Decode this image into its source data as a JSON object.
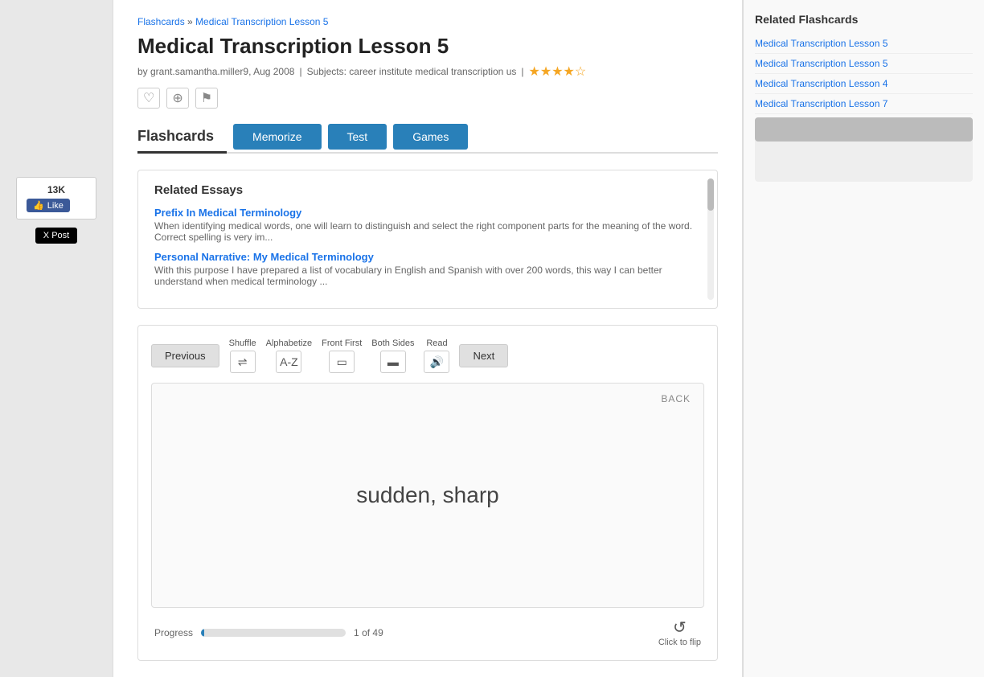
{
  "breadcrumb": {
    "home_label": "Flashcards",
    "separator": "»",
    "current": "Medical Transcription Lesson 5"
  },
  "page_title": "Medical Transcription Lesson 5",
  "meta": {
    "author": "by grant.samantha.miller9, Aug 2008",
    "separator": "|",
    "subjects": "Subjects: career institute medical transcription us",
    "stars": "★★★★☆"
  },
  "action_icons": {
    "heart": "♡",
    "add": "⊕",
    "flag": "⚑"
  },
  "tabs": {
    "flashcards_label": "Flashcards",
    "memorize_label": "Memorize",
    "test_label": "Test",
    "games_label": "Games"
  },
  "related_essays": {
    "title": "Related Essays",
    "items": [
      {
        "title": "Prefix In Medical Terminology",
        "desc": "When identifying medical words, one will learn to distinguish and select the right component parts for the meaning of the word. Correct spelling is very im..."
      },
      {
        "title": "Personal Narrative: My Medical Terminology",
        "desc": "With this purpose I have prepared a list of vocabulary in English and Spanish with over 200 words, this way I can better understand when medical terminology ..."
      }
    ]
  },
  "flashcard_controls": {
    "prev_label": "Previous",
    "next_label": "Next",
    "shuffle_label": "Shuffle",
    "shuffle_icon": "⇌",
    "alphabetize_label": "Alphabetize",
    "alphabetize_icon": "A-Z",
    "front_first_label": "Front First",
    "front_first_icon": "▭",
    "both_sides_label": "Both Sides",
    "both_sides_icon": "▬",
    "read_label": "Read",
    "read_icon": "🔊"
  },
  "card": {
    "back_label": "BACK",
    "text": "sudden, sharp",
    "flip_label": "Click to flip",
    "flip_icon": "↺"
  },
  "progress": {
    "label": "Progress",
    "current": "1",
    "total": "49",
    "of": "of",
    "percent": 2
  },
  "social": {
    "fb_count": "13K",
    "fb_like": "Like",
    "x_post": "X Post"
  },
  "related_flashcards": {
    "title": "Related Flashcards",
    "items": [
      "Medical Transcription Lesson 5",
      "Medical Transcription Lesson 5",
      "Medical Transcription Lesson 4",
      "Medical Transcription Lesson 7"
    ]
  }
}
